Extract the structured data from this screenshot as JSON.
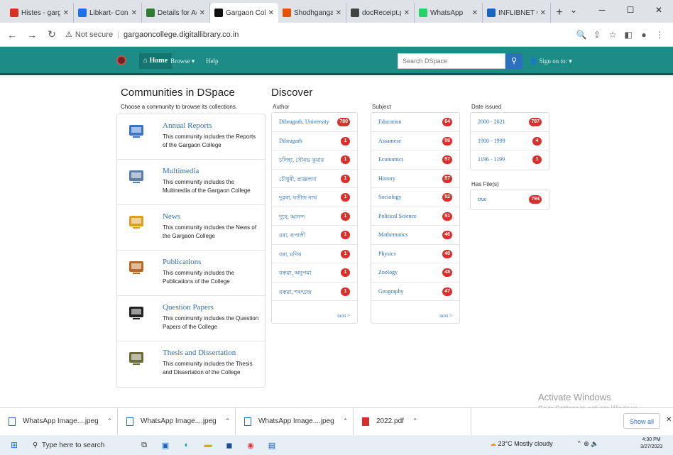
{
  "browser": {
    "tabs": [
      {
        "title": "Histes - garga",
        "color": "#d93025"
      },
      {
        "title": "Libkart- Conse",
        "color": "#1a73e8"
      },
      {
        "title": "Details for Acc",
        "color": "#2e7d32"
      },
      {
        "title": "Gargaon Colle",
        "color": "#111111",
        "active": true
      },
      {
        "title": "Shodhganga",
        "color": "#e65100"
      },
      {
        "title": "docReceipt.p",
        "color": "#424242"
      },
      {
        "title": "WhatsApp",
        "color": "#25d366"
      },
      {
        "title": "INFLIBNET Ce",
        "color": "#1565c0"
      }
    ],
    "new_tab": "+",
    "address": {
      "security": "Not secure",
      "url": "gargaoncollege.digitallibrary.co.in"
    }
  },
  "dspace_nav": {
    "home": "Home",
    "browse": "Browse",
    "help": "Help",
    "search_placeholder": "Search DSpace",
    "signin": "Sign on to:"
  },
  "communities": {
    "title": "Communities in DSpace",
    "subtitle": "Choose a community to browse its collections.",
    "items": [
      {
        "name": "Annual Reports",
        "desc": "This community includes the Reports of the Gargaon College"
      },
      {
        "name": "Multimedia",
        "desc": "This community includes the Multimedia of the Gargaon College"
      },
      {
        "name": "News",
        "desc": "This community includes the News of the Gargaon College"
      },
      {
        "name": "Publications",
        "desc": "This community includes the Publications of the College"
      },
      {
        "name": "Question Papers",
        "desc": "This community includes the Question Papers of the College"
      },
      {
        "name": "Thesis and Dissertation",
        "desc": "This community includes the Thesis and Dissertation of the College"
      }
    ]
  },
  "discover": {
    "title": "Discover",
    "author": {
      "label": "Author",
      "next": "next >",
      "items": [
        {
          "name": "Dibrugarh, University",
          "count": "780"
        },
        {
          "name": "Dibrugarh",
          "count": "1"
        },
        {
          "name": "চলিহা, সৌৰভ কুমাৰ",
          "count": "1"
        },
        {
          "name": "চৌধুৰী, প্ৰাঞ্জলদা",
          "count": "1"
        },
        {
          "name": "দুৱৰা, যতীন্দ্ৰ নাথ",
          "count": "1"
        },
        {
          "name": "দুবে, আনন্দ",
          "count": "1"
        },
        {
          "name": "বৰা, ৰূপালী",
          "count": "1"
        },
        {
          "name": "বৰা, মণিৰ",
          "count": "1"
        },
        {
          "name": "বৰুৱা, অনুপমা",
          "count": "1"
        },
        {
          "name": "বৰুৱা, শৰৎচন্দ্ৰ",
          "count": "1"
        }
      ]
    },
    "subject": {
      "label": "Subject",
      "next": "next >",
      "items": [
        {
          "name": "Education",
          "count": "64"
        },
        {
          "name": "Assamese",
          "count": "58"
        },
        {
          "name": "Economics",
          "count": "57"
        },
        {
          "name": "History",
          "count": "57"
        },
        {
          "name": "Sociology",
          "count": "52"
        },
        {
          "name": "Political Science",
          "count": "51"
        },
        {
          "name": "Mathematics",
          "count": "46"
        },
        {
          "name": "Physics",
          "count": "48"
        },
        {
          "name": "Zoology",
          "count": "48"
        },
        {
          "name": "Geography",
          "count": "47"
        }
      ]
    },
    "date": {
      "label": "Date issued",
      "items": [
        {
          "name": "2000 - 2021",
          "count": "787"
        },
        {
          "name": "1900 - 1999",
          "count": "4"
        },
        {
          "name": "1196 - 1199",
          "count": "1"
        }
      ]
    },
    "hasfile": {
      "label": "Has File(s)",
      "items": [
        {
          "name": "true",
          "count": "794"
        }
      ]
    }
  },
  "windows_watermark": {
    "line1": "Activate Windows",
    "line2": "Go to Settings to activate Windows."
  },
  "downloads": {
    "items": [
      "WhatsApp Image....jpeg",
      "WhatsApp Image....jpeg",
      "WhatsApp Image....jpeg",
      "2022.pdf"
    ],
    "show_all": "Show all",
    "close": "✕"
  },
  "taskbar": {
    "search_placeholder": "Type here to search",
    "weather": "23°C  Mostly cloudy",
    "time": "4:30 PM",
    "date": "3/27/2023"
  }
}
